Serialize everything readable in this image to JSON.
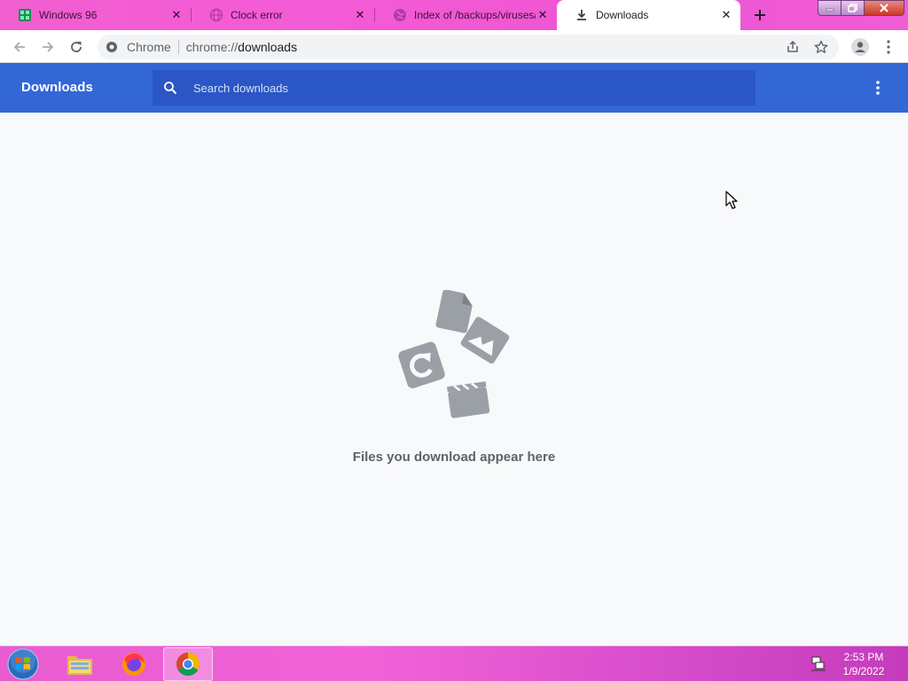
{
  "tabs": [
    {
      "title": "Windows 96",
      "icon": "windows96-icon"
    },
    {
      "title": "Clock error",
      "icon": "globe-icon"
    },
    {
      "title": "Index of /backups/viruses/",
      "icon": "globe-icon"
    },
    {
      "title": "Downloads",
      "icon": "download-icon",
      "active": true
    }
  ],
  "omnibox": {
    "chip": "Chrome",
    "url_scheme": "chrome://",
    "url_host": "downloads"
  },
  "downloads": {
    "title": "Downloads",
    "search_placeholder": "Search downloads",
    "empty_text": "Files you download appear here"
  },
  "taskbar": {
    "time": "2:53 PM",
    "date": "1/9/2022",
    "items": [
      "windows-explorer-icon",
      "firefox-icon",
      "chrome-icon"
    ]
  },
  "colors": {
    "accent": "#3367d6",
    "tabstrip": "#f25fd0",
    "taskbar": "#e85cd0"
  }
}
